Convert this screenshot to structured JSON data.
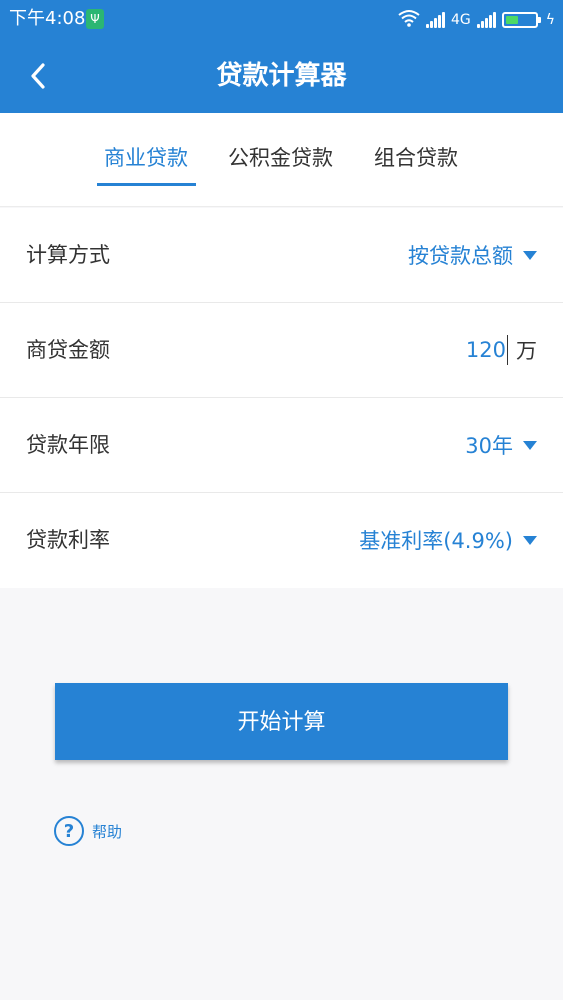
{
  "status_bar": {
    "time": "下午4:08",
    "network": "4G"
  },
  "header": {
    "title": "贷款计算器"
  },
  "tabs": [
    {
      "label": "商业贷款",
      "active": true
    },
    {
      "label": "公积金贷款",
      "active": false
    },
    {
      "label": "组合贷款",
      "active": false
    }
  ],
  "form": {
    "calc_method": {
      "label": "计算方式",
      "value": "按贷款总额"
    },
    "loan_amount": {
      "label": "商贷金额",
      "value": "120",
      "unit": "万"
    },
    "loan_term": {
      "label": "贷款年限",
      "value": "30年"
    },
    "loan_rate": {
      "label": "贷款利率",
      "value": "基准利率(4.9%)"
    }
  },
  "actions": {
    "calculate_label": "开始计算",
    "help_label": "帮助"
  },
  "colors": {
    "primary": "#2682d4",
    "text": "#333333",
    "background": "#f7f7f9"
  }
}
